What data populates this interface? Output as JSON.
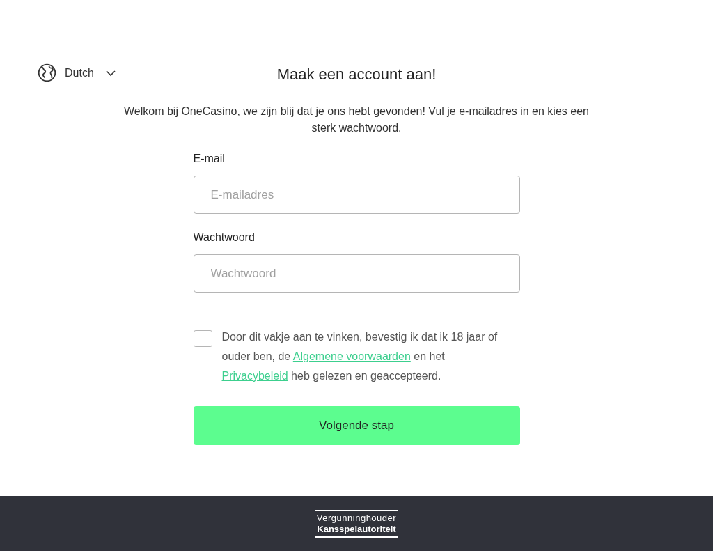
{
  "language": {
    "label": "Dutch"
  },
  "title": "Maak een account aan!",
  "intro": "Welkom bij OneCasino, we zijn blij dat je ons hebt gevonden! Vul je e-mailadres in en kies een sterk wachtwoord.",
  "fields": [
    {
      "label": "E-mail",
      "placeholder": "E-mailadres"
    },
    {
      "label": "Wachtwoord",
      "placeholder": "Wachtwoord"
    }
  ],
  "consent": {
    "checked": false,
    "parts": [
      {
        "kind": "text",
        "text": "Door dit vakje aan te vinken, bevestig ik dat ik 18 jaar of ouder ben, de "
      },
      {
        "kind": "link",
        "text": "Algemene voorwaarden"
      },
      {
        "kind": "text",
        "text": " en het "
      },
      {
        "kind": "link",
        "text": "Privacybeleid"
      },
      {
        "kind": "text",
        "text": " heb gelezen en geaccepteerd."
      }
    ]
  },
  "submit": "Volgende stap",
  "footer": {
    "badge_line_1": "Vergunninghouder",
    "badge_line_2": "Kansspelautoriteit"
  }
}
